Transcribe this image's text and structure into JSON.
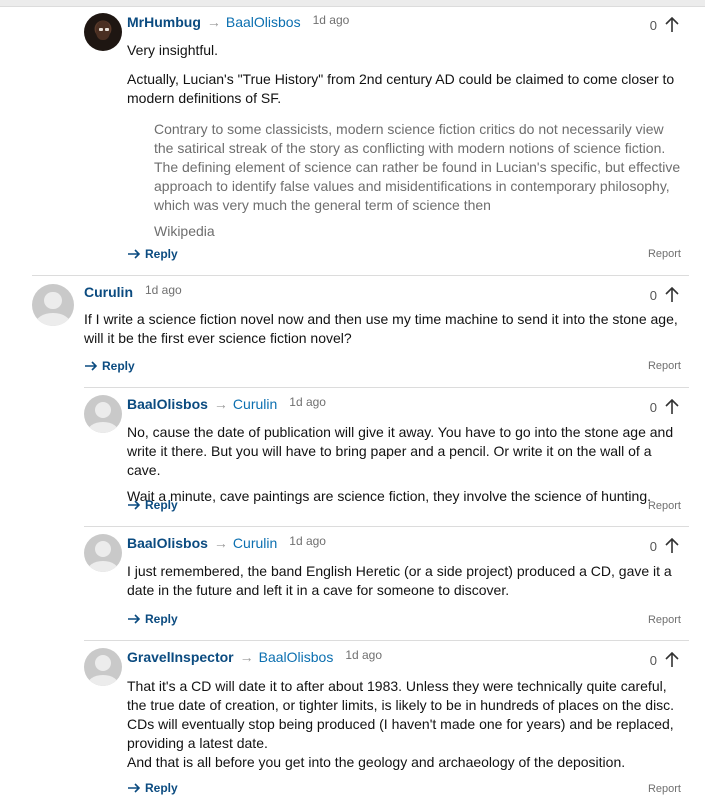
{
  "ui": {
    "reply_label": "Reply",
    "report_label": "Report"
  },
  "comments": [
    {
      "author": "MrHumbug",
      "reply_to": "BaalOlisbos",
      "time": "1d ago",
      "votes": "0",
      "paragraphs": [
        "Very insightful.",
        "Actually, Lucian's \"True History\" from 2nd century AD could be claimed to come closer to modern definitions of SF."
      ],
      "quote": "Contrary to some classicists, modern science fiction critics do not necessarily view the satirical streak of the story as conflicting with modern notions of science fiction. The defining element of science can rather be found in Lucian's specific, but effective approach to identify false values and misidentifications in contemporary philosophy, which was very much the general term of science then",
      "quote_source": "Wikipedia"
    },
    {
      "author": "Curulin",
      "reply_to": "",
      "time": "1d ago",
      "votes": "0",
      "paragraphs": [
        "If I write a science fiction novel now and then use my time machine to send it into the stone age, will it be the first ever science fiction novel?"
      ]
    },
    {
      "author": "BaalOlisbos",
      "reply_to": "Curulin",
      "time": "1d ago",
      "votes": "0",
      "paragraphs": [
        "No, cause the date of publication will give it away. You have to go into the stone age and write it there. But you will have to bring paper and a pencil. Or write it on the wall of a cave.",
        "Wait a minute, cave paintings are science fiction, they involve the science of hunting."
      ]
    },
    {
      "author": "BaalOlisbos",
      "reply_to": "Curulin",
      "time": "1d ago",
      "votes": "0",
      "paragraphs": [
        "I just remembered, the band English Heretic (or a side project) produced a CD, gave it a date in the future and left it in a cave for someone to discover."
      ]
    },
    {
      "author": "GravelInspector",
      "reply_to": "BaalOlisbos",
      "time": "1d ago",
      "votes": "0",
      "paragraphs": [
        "That it's a CD will date it to after about 1983. Unless they were technically quite careful, the true date of creation, or tighter limits, is likely to be in hundreds of places on the disc. CDs will eventually stop being produced (I haven't made one for years) and be replaced, providing a latest date.",
        "And that is all before you get into the geology and archaeology of the deposition."
      ]
    }
  ]
}
